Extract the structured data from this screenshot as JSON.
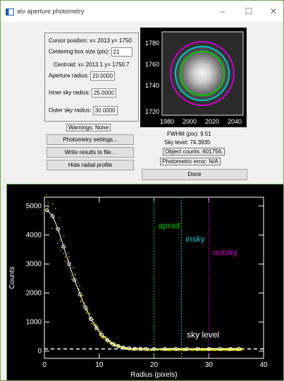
{
  "window": {
    "title": "atv aperture photometry"
  },
  "controls": {
    "cursor_position": "Cursor position: x= 2013 y= 1750",
    "centering_label": "Centering box size (pix):",
    "centering_value": "21",
    "centroid": "Centroid:   x= 2013.1 y= 1750.7",
    "aperture_label": "Aperture radius:",
    "aperture_value": "20.0000",
    "inner_label": "Inner sky radius:",
    "inner_value": "25.0000",
    "outer_label": "Outer sky radius:",
    "outer_value": "30.0000",
    "warnings": "Warnings: None",
    "photometry_settings": "Photometry settings...",
    "write_results": "Write results to file...",
    "hide_profile": "Hide radial profile"
  },
  "image": {
    "y_ticks": [
      "1780",
      "1760",
      "1740",
      "1720"
    ],
    "x_ticks": [
      "1980",
      "2000",
      "2020",
      "2040"
    ]
  },
  "stats": {
    "fwhm": "FWHM (pix):     9.51",
    "sky": "Sky level:     74.3935",
    "counts": "Object counts: 601756.",
    "error": "Photometric error: N/A",
    "done": "Done"
  },
  "colors": {
    "aprad": "#00cc00",
    "insky": "#00cccc",
    "outsky": "#cc00cc",
    "data": "#e8e800"
  },
  "chart_data": {
    "type": "scatter",
    "xlabel": "Radius (pixels)",
    "ylabel": "Counts",
    "xlim": [
      0,
      40
    ],
    "ylim": [
      -250,
      5300
    ],
    "x_ticks": [
      0,
      10,
      20,
      30,
      40
    ],
    "y_ticks": [
      0,
      1000,
      2000,
      3000,
      4000,
      5000
    ],
    "lines": [
      {
        "name": "aprad",
        "x": 20
      },
      {
        "name": "insky",
        "x": 25
      },
      {
        "name": "outsky",
        "x": 30
      }
    ],
    "sky_level": {
      "name": "sky level",
      "y": 74.3935
    },
    "profile": {
      "x": [
        0.5,
        1.5,
        2.5,
        3.5,
        4.5,
        5.5,
        6.5,
        7.5,
        8.5,
        9.5,
        10.5,
        11.5,
        12.5,
        13.5,
        14.5,
        15.5,
        16.5,
        17.5,
        18.5,
        20,
        22,
        24,
        26,
        28,
        30,
        32,
        34,
        35.5
      ],
      "y": [
        4850,
        4650,
        4200,
        3600,
        3000,
        2450,
        1950,
        1500,
        1100,
        800,
        560,
        380,
        250,
        170,
        120,
        95,
        85,
        78,
        75,
        74,
        74,
        74,
        74,
        74,
        74,
        74,
        74,
        74
      ]
    }
  }
}
